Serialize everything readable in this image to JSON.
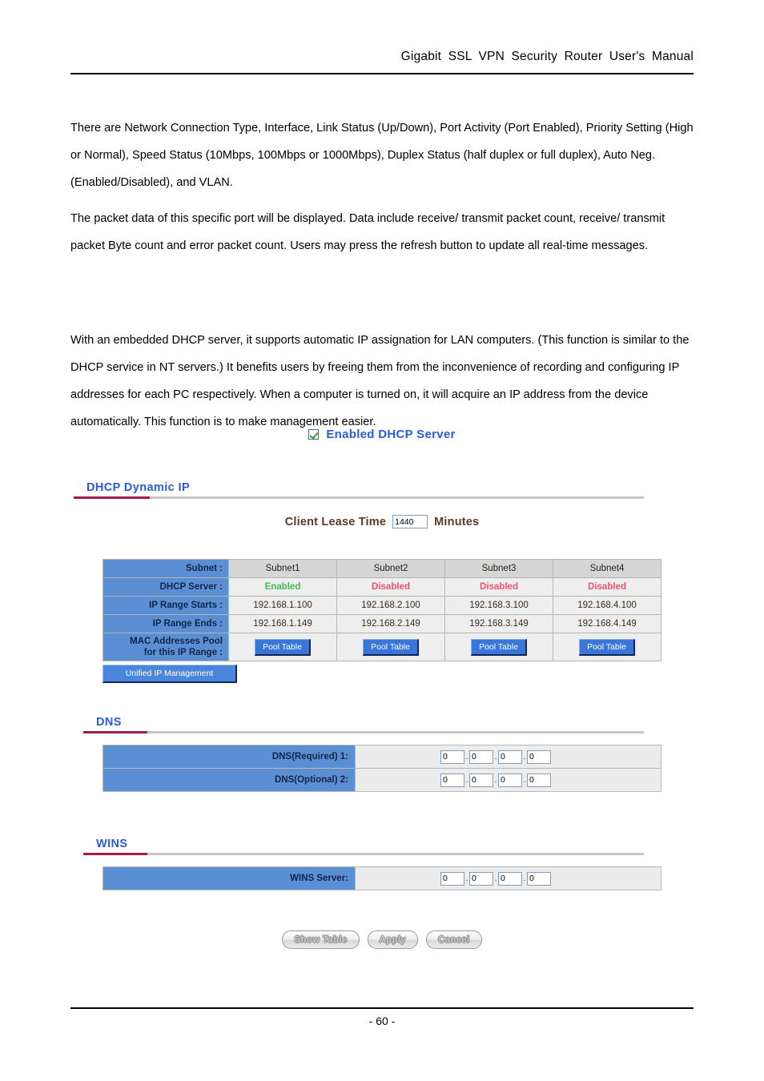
{
  "header": {
    "title": "Gigabit  SSL  VPN  Security  Router  User's  Manual"
  },
  "paragraphs": {
    "p1": "There are Network Connection Type, Interface, Link Status (Up/Down), Port Activity (Port Enabled), Priority Setting (High or Normal), Speed Status (10Mbps, 100Mbps or 1000Mbps), Duplex Status (half duplex or full duplex), Auto Neg. (Enabled/Disabled), and VLAN.",
    "p2": "The packet data of this specific port will be displayed. Data include receive/ transmit packet count, receive/ transmit packet Byte count and error packet count. Users may press the refresh button to update all real-time messages.",
    "p3": "With an embedded DHCP server, it supports automatic IP assignation for LAN computers. (This function is similar to the DHCP service in NT servers.) It benefits users by freeing them from the inconvenience of recording and configuring IP addresses for each PC respectively. When a computer is turned on, it will acquire an IP address from the device automatically. This function is to make management easier."
  },
  "dhcp_enable": {
    "label": "Enabled DHCP Server",
    "checked": true,
    "checkbox_icon": "checkbox-checked-icon",
    "label_color": "#2a5bd7",
    "check_color": "#2e9b33"
  },
  "sections": {
    "dhcp_dynamic_ip": {
      "title": "DHCP Dynamic IP"
    },
    "dns": {
      "title": "DNS"
    },
    "wins": {
      "title": "WINS"
    }
  },
  "lease": {
    "label": "Client Lease Time",
    "value": "1440",
    "units": "Minutes"
  },
  "subnet_table": {
    "rows": [
      {
        "label": "Subnet :",
        "type": "header",
        "values": [
          "Subnet1",
          "Subnet2",
          "Subnet3",
          "Subnet4"
        ]
      },
      {
        "label": "DHCP Server :",
        "type": "status",
        "values": [
          "Enabled",
          "Disabled",
          "Disabled",
          "Disabled"
        ],
        "states": [
          "enabled",
          "disabled",
          "disabled",
          "disabled"
        ]
      },
      {
        "label": "IP Range Starts :",
        "type": "text",
        "values": [
          "192.168.1.100",
          "192.168.2.100",
          "192.168.3.100",
          "192.168.4.100"
        ]
      },
      {
        "label": "IP Range Ends :",
        "type": "text",
        "values": [
          "192.168.1.149",
          "192.168.2.149",
          "192.168.3.149",
          "192.168.4.149"
        ]
      },
      {
        "label": "MAC Addresses Pool for this IP Range :",
        "label_line1": "MAC Addresses Pool",
        "label_line2": "for this IP Range :",
        "type": "button",
        "values": [
          "Pool Table",
          "Pool Table",
          "Pool Table",
          "Pool Table"
        ]
      }
    ],
    "label_bg": "#5b8fd4",
    "enabled_color": "#3cc14a",
    "disabled_color": "#f0536b"
  },
  "unified_button": {
    "label": "Unified IP Management"
  },
  "dns_table": {
    "rows": [
      {
        "label": "DNS(Required) 1:",
        "octets": [
          "0",
          "0",
          "0",
          "0"
        ]
      },
      {
        "label": "DNS(Optional) 2:",
        "octets": [
          "0",
          "0",
          "0",
          "0"
        ]
      }
    ]
  },
  "wins_table": {
    "rows": [
      {
        "label": "WINS Server:",
        "octets": [
          "0",
          "0",
          "0",
          "0"
        ]
      }
    ]
  },
  "buttons": {
    "show_table": "Show Table",
    "apply": "Apply",
    "cancel": "Cancel"
  },
  "footer": {
    "page": "- 60 -"
  }
}
